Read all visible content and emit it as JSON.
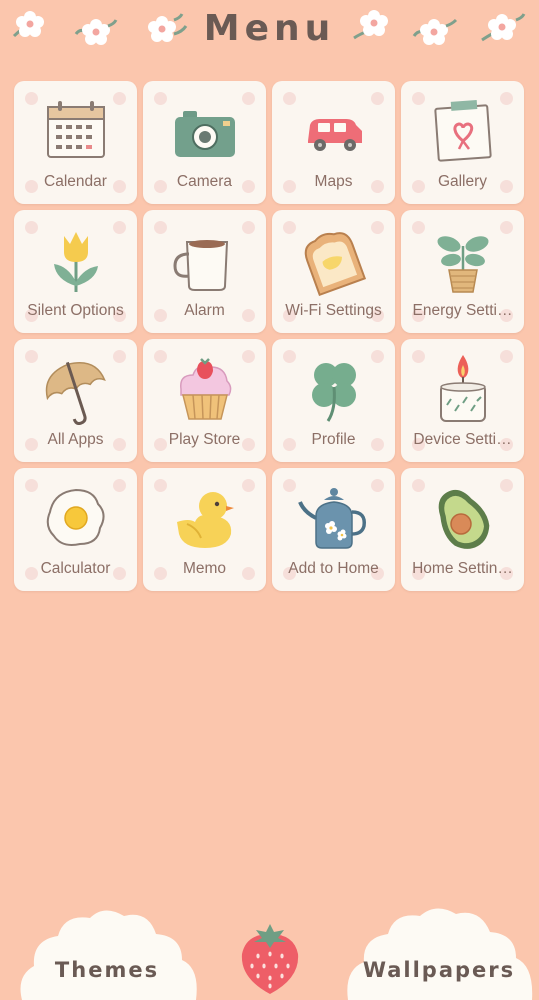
{
  "header": {
    "title": "Menu"
  },
  "apps": [
    {
      "label": "Calendar",
      "icon": "calendar-icon"
    },
    {
      "label": "Camera",
      "icon": "camera-icon"
    },
    {
      "label": "Maps",
      "icon": "car-icon"
    },
    {
      "label": "Gallery",
      "icon": "photo-heart-icon"
    },
    {
      "label": "Silent Options",
      "icon": "tulip-icon"
    },
    {
      "label": "Alarm",
      "icon": "coffee-mug-icon"
    },
    {
      "label": "Wi-Fi Settings",
      "icon": "toast-icon"
    },
    {
      "label": "Energy Setti…",
      "icon": "potted-plant-icon"
    },
    {
      "label": "All Apps",
      "icon": "umbrella-icon"
    },
    {
      "label": "Play Store",
      "icon": "cupcake-icon"
    },
    {
      "label": "Profile",
      "icon": "clover-icon"
    },
    {
      "label": "Device Setti…",
      "icon": "candle-icon"
    },
    {
      "label": "Calculator",
      "icon": "fried-egg-icon"
    },
    {
      "label": "Memo",
      "icon": "chick-icon"
    },
    {
      "label": "Add to Home",
      "icon": "teapot-icon"
    },
    {
      "label": "Home Settin…",
      "icon": "avocado-icon"
    }
  ],
  "bottom_bar": {
    "themes_label": "Themes",
    "wallpapers_label": "Wallpapers",
    "center_icon": "strawberry-icon"
  },
  "colors": {
    "background": "#fbc6ad",
    "tile": "#fbf6f0",
    "label_text": "#8c6f66",
    "title_text": "#6a5a54"
  }
}
